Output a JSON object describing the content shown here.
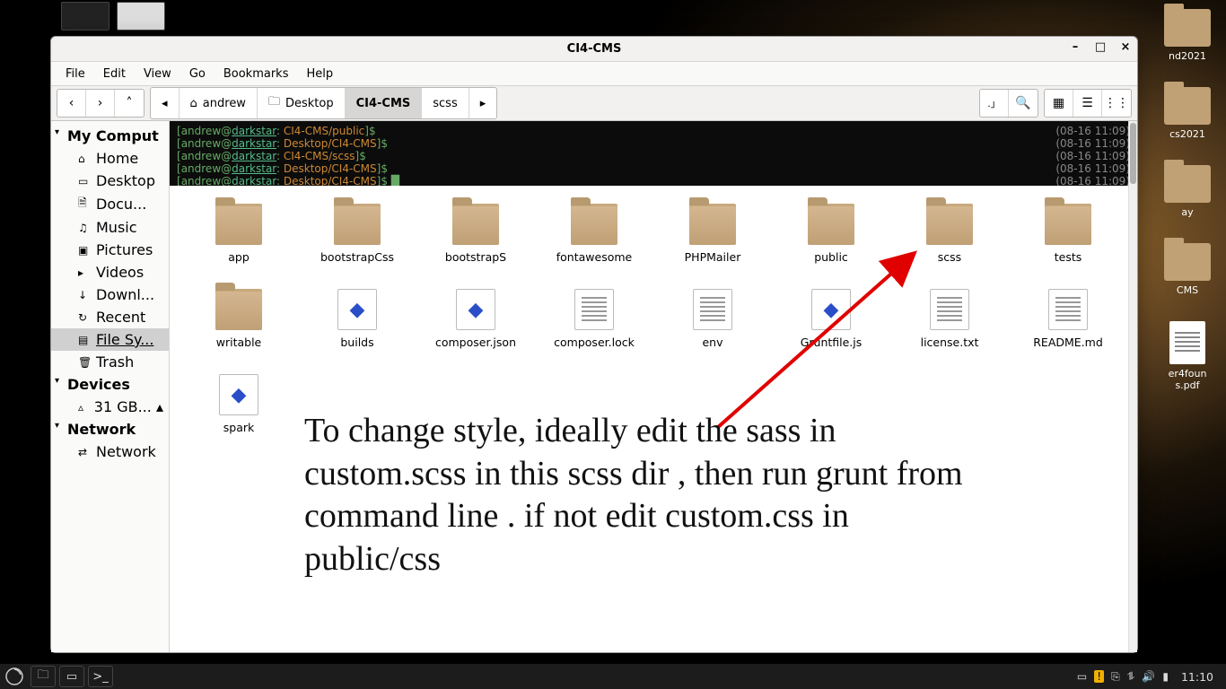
{
  "window": {
    "title": "CI4-CMS",
    "minimize": "–",
    "maximize": "□",
    "close": "×"
  },
  "menu": {
    "file": "File",
    "edit": "Edit",
    "view": "View",
    "go": "Go",
    "bookmarks": "Bookmarks",
    "help": "Help"
  },
  "path": {
    "home_user": "andrew",
    "desktop": "Desktop",
    "proj": "CI4-CMS",
    "sub": "scss"
  },
  "sidebar": {
    "groups": [
      {
        "label": "My Comput",
        "items": [
          {
            "icon": "⌂",
            "label": "Home"
          },
          {
            "icon": "▭",
            "label": "Desktop"
          },
          {
            "icon": "🗎",
            "label": "Docu..."
          },
          {
            "icon": "♫",
            "label": "Music"
          },
          {
            "icon": "▣",
            "label": "Pictures"
          },
          {
            "icon": "▸",
            "label": "Videos"
          },
          {
            "icon": "↓",
            "label": "Downl..."
          },
          {
            "icon": "↻",
            "label": "Recent"
          },
          {
            "icon": "▤",
            "label": "File Sy...",
            "selected": true
          },
          {
            "icon": "🗑",
            "label": "Trash"
          }
        ]
      },
      {
        "label": "Devices",
        "items": [
          {
            "icon": "▵",
            "label": "31 GB... ▴"
          }
        ]
      },
      {
        "label": "Network",
        "items": [
          {
            "icon": "⇄",
            "label": "Network"
          }
        ]
      }
    ]
  },
  "terminal": {
    "lines": [
      {
        "user": "andrew",
        "host": "darkstar",
        "path": " CI4-CMS/public",
        "ts": "(08-16 11:09)"
      },
      {
        "user": "andrew",
        "host": "darkstar",
        "path": " Desktop/CI4-CMS",
        "ts": "(08-16 11:09)"
      },
      {
        "user": "andrew",
        "host": "darkstar",
        "path": " CI4-CMS/scss",
        "ts": "(08-16 11:09)"
      },
      {
        "user": "andrew",
        "host": "darkstar",
        "path": " Desktop/CI4-CMS",
        "ts": "(08-16 11:09)"
      },
      {
        "user": "andrew",
        "host": "darkstar",
        "path": " Desktop/CI4-CMS",
        "ts": "(08-16 11:09)"
      }
    ]
  },
  "files": [
    {
      "name": "app",
      "type": "folder"
    },
    {
      "name": "bootstrapCss",
      "type": "folder"
    },
    {
      "name": "bootstrapS",
      "type": "folder"
    },
    {
      "name": "fontawesome",
      "type": "folder"
    },
    {
      "name": "PHPMailer",
      "type": "folder"
    },
    {
      "name": "public",
      "type": "folder"
    },
    {
      "name": "scss",
      "type": "folder"
    },
    {
      "name": "tests",
      "type": "folder"
    },
    {
      "name": "writable",
      "type": "folder"
    },
    {
      "name": "builds",
      "type": "gem"
    },
    {
      "name": "composer.json",
      "type": "gem"
    },
    {
      "name": "composer.lock",
      "type": "txt"
    },
    {
      "name": "env",
      "type": "txt"
    },
    {
      "name": "Gruntfile.js",
      "type": "gem"
    },
    {
      "name": "license.txt",
      "type": "txt"
    },
    {
      "name": "README.md",
      "type": "txt"
    },
    {
      "name": "spark",
      "type": "gem"
    }
  ],
  "annotation": "To change style, ideally edit the sass in custom.scss in this scss dir , then run grunt from command line . if not edit custom.css in public/css",
  "desktop_icons": [
    {
      "type": "folder",
      "label": "nd2021"
    },
    {
      "type": "folder",
      "label": "cs2021"
    },
    {
      "type": "folder",
      "label": "ay"
    },
    {
      "type": "folder",
      "label": "CMS"
    },
    {
      "type": "doc",
      "label": "er4foun\ns.pdf"
    }
  ],
  "panel": {
    "clock": "11:10"
  }
}
